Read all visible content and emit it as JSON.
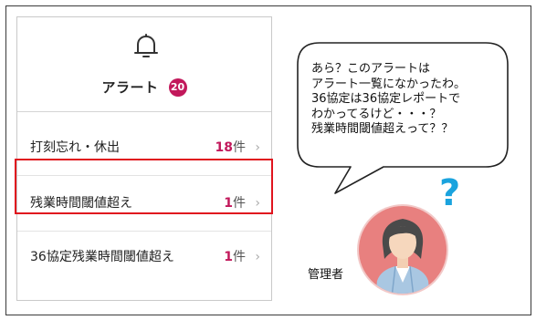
{
  "alert_panel": {
    "title": "アラート",
    "badge_count": "20",
    "items": [
      {
        "label": "打刻忘れ・休出",
        "count": "18",
        "unit": "件",
        "chevron": "›"
      },
      {
        "label": "残業時間閾値超え",
        "count": "1",
        "unit": "件",
        "chevron": "›"
      },
      {
        "label": "36協定残業時間閾値超え",
        "count": "1",
        "unit": "件",
        "chevron": "›"
      }
    ],
    "icon": "bell-icon"
  },
  "speech_bubble": {
    "text": "あら？このアラートは\nアラート一覧になかったわ。\n36協定は36協定レポートで\nわかってるけど・・・？\n残業時間閾値超えって？？"
  },
  "question_mark": "?",
  "person": {
    "role": "管理者",
    "icon": "person-avatar-icon"
  },
  "colors": {
    "badge": "#c2185b",
    "count": "#c2185b",
    "highlight": "#e0141e",
    "question_mark": "#1aa3de",
    "avatar_bg": "#e8807f"
  }
}
